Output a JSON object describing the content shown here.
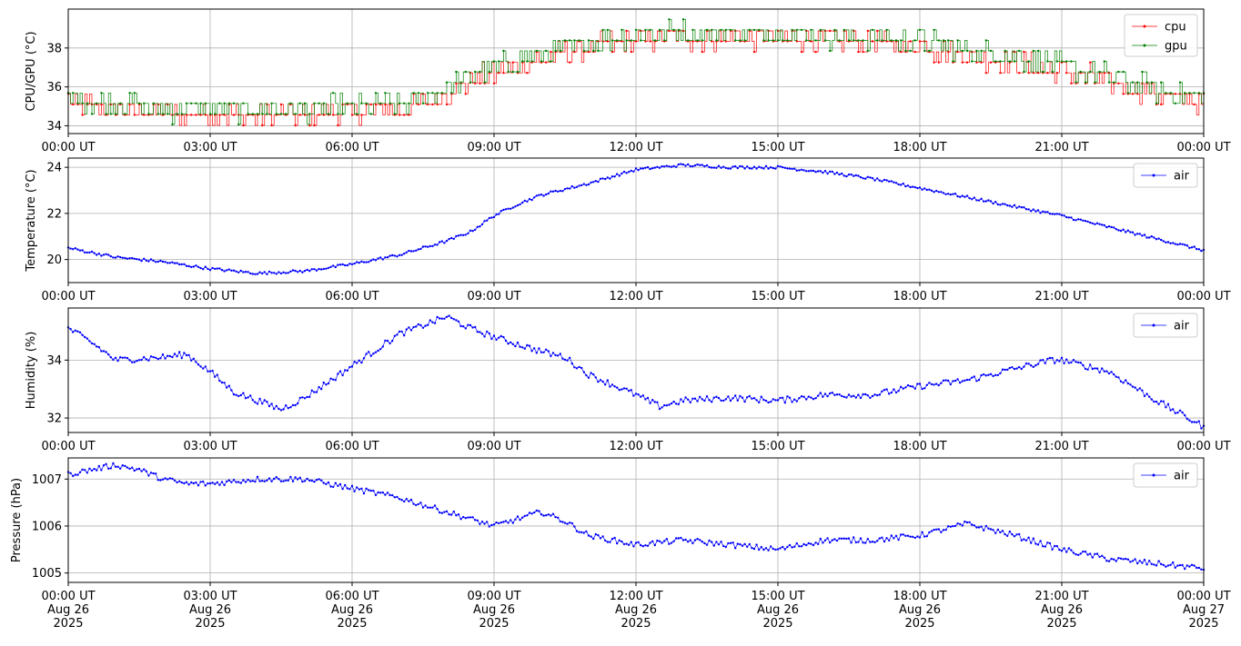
{
  "chart_data": [
    {
      "type": "line",
      "ylabel": "CPU/GPU (°C)",
      "xlim": [
        "2025-08-26T00:00Z",
        "2025-08-27T00:00Z"
      ],
      "ylim": [
        33.6,
        40.0
      ],
      "yticks": [
        34,
        36,
        38
      ],
      "grid": true,
      "legend_position": "top-right",
      "x_tick_labels": [
        "00:00 UT",
        "03:00 UT",
        "06:00 UT",
        "09:00 UT",
        "12:00 UT",
        "15:00 UT",
        "18:00 UT",
        "21:00 UT",
        "00:00 UT"
      ],
      "series": [
        {
          "name": "cpu",
          "color": "#ff0000",
          "time_hours": [
            0,
            1,
            2,
            3,
            4,
            5,
            6,
            7,
            7.5,
            8,
            8.5,
            9,
            9.5,
            10,
            11,
            12,
            13,
            14,
            15,
            16,
            17,
            18,
            19,
            20,
            21,
            22,
            23,
            24
          ],
          "values": [
            35.2,
            34.9,
            34.6,
            34.6,
            34.5,
            34.6,
            34.7,
            34.8,
            35.2,
            35.7,
            36.3,
            36.7,
            37.0,
            37.4,
            38.0,
            38.4,
            38.5,
            38.5,
            38.5,
            38.4,
            38.3,
            38.1,
            37.6,
            37.3,
            36.8,
            36.3,
            35.6,
            35.2
          ]
        },
        {
          "name": "gpu",
          "color": "#008000",
          "time_hours": [
            0,
            1,
            2,
            3,
            4,
            5,
            6,
            7,
            7.5,
            8,
            8.5,
            9,
            9.5,
            10,
            11,
            12,
            13,
            14,
            15,
            16,
            17,
            18,
            19,
            20,
            21,
            22,
            23,
            24
          ],
          "values": [
            35.4,
            35.1,
            34.8,
            34.8,
            34.7,
            34.8,
            34.9,
            35.0,
            35.4,
            35.9,
            36.5,
            36.9,
            37.2,
            37.6,
            38.2,
            38.6,
            38.7,
            38.7,
            38.7,
            38.6,
            38.5,
            38.3,
            37.8,
            37.5,
            37.0,
            36.5,
            35.8,
            35.4
          ]
        }
      ]
    },
    {
      "type": "line",
      "ylabel": "Temperature (°C)",
      "xlim": [
        "2025-08-26T00:00Z",
        "2025-08-27T00:00Z"
      ],
      "ylim": [
        19.0,
        24.4
      ],
      "yticks": [
        20,
        22,
        24
      ],
      "grid": true,
      "legend_position": "top-right",
      "x_tick_labels": [
        "00:00 UT",
        "03:00 UT",
        "06:00 UT",
        "09:00 UT",
        "12:00 UT",
        "15:00 UT",
        "18:00 UT",
        "21:00 UT",
        "00:00 UT"
      ],
      "series": [
        {
          "name": "air",
          "color": "#0000ff",
          "time_hours": [
            0,
            1,
            2,
            3,
            4,
            5,
            6,
            7,
            8,
            8.5,
            9,
            9.5,
            10,
            11,
            12,
            13,
            14,
            15,
            16,
            17,
            18,
            19,
            20,
            21,
            22,
            23,
            24
          ],
          "values": [
            20.5,
            20.1,
            19.9,
            19.6,
            19.4,
            19.5,
            19.8,
            20.2,
            20.8,
            21.2,
            21.9,
            22.4,
            22.8,
            23.3,
            23.9,
            24.1,
            24.0,
            24.0,
            23.8,
            23.5,
            23.1,
            22.7,
            22.3,
            21.9,
            21.4,
            20.9,
            20.4
          ]
        }
      ]
    },
    {
      "type": "line",
      "ylabel": "Humidity (%)",
      "xlim": [
        "2025-08-26T00:00Z",
        "2025-08-27T00:00Z"
      ],
      "ylim": [
        31.5,
        35.8
      ],
      "yticks": [
        32,
        34
      ],
      "grid": true,
      "legend_position": "top-right",
      "x_tick_labels": [
        "00:00 UT",
        "03:00 UT",
        "06:00 UT",
        "09:00 UT",
        "12:00 UT",
        "15:00 UT",
        "18:00 UT",
        "21:00 UT",
        "00:00 UT"
      ],
      "series": [
        {
          "name": "air",
          "color": "#0000ff",
          "time_hours": [
            0,
            0.5,
            1,
            2,
            2.5,
            3,
            3.5,
            4.5,
            5,
            6,
            7,
            8,
            8.5,
            9,
            10,
            10.5,
            11,
            12,
            12.5,
            13,
            14,
            15,
            16,
            17,
            18,
            19,
            20,
            20.8,
            21,
            22,
            23,
            24
          ],
          "values": [
            35.1,
            34.6,
            34.0,
            34.1,
            34.2,
            33.6,
            32.9,
            32.3,
            32.7,
            33.8,
            34.9,
            35.5,
            35.1,
            34.8,
            34.3,
            34.1,
            33.5,
            32.8,
            32.4,
            32.6,
            32.7,
            32.6,
            32.8,
            32.8,
            33.1,
            33.3,
            33.7,
            34.0,
            34.0,
            33.6,
            32.6,
            31.7
          ]
        }
      ]
    },
    {
      "type": "line",
      "ylabel": "Pressure (hPa)",
      "xlim": [
        "2025-08-26T00:00Z",
        "2025-08-27T00:00Z"
      ],
      "ylim": [
        1004.8,
        1007.45
      ],
      "yticks": [
        1005,
        1006,
        1007
      ],
      "grid": true,
      "legend_position": "top-right",
      "x_tick_labels": [
        "00:00 UT\nAug 26\n2025",
        "03:00 UT\nAug 26\n2025",
        "06:00 UT\nAug 26\n2025",
        "09:00 UT\nAug 26\n2025",
        "12:00 UT\nAug 26\n2025",
        "15:00 UT\nAug 26\n2025",
        "18:00 UT\nAug 26\n2025",
        "21:00 UT\nAug 26\n2025",
        "00:00 UT\nAug 27\n2025"
      ],
      "series": [
        {
          "name": "air",
          "color": "#0000ff",
          "time_hours": [
            0,
            0.5,
            1,
            1.5,
            2,
            2.5,
            3,
            4,
            5,
            6,
            7,
            8,
            9,
            10,
            10.5,
            11,
            12,
            13,
            14,
            15,
            16,
            17,
            18,
            19,
            20,
            21,
            22,
            23,
            24
          ],
          "values": [
            1007.1,
            1007.2,
            1007.3,
            1007.2,
            1007.0,
            1006.9,
            1006.9,
            1007.0,
            1007.0,
            1006.8,
            1006.6,
            1006.3,
            1006.0,
            1006.3,
            1006.1,
            1005.8,
            1005.6,
            1005.7,
            1005.6,
            1005.5,
            1005.7,
            1005.7,
            1005.8,
            1006.05,
            1005.8,
            1005.5,
            1005.3,
            1005.2,
            1005.1
          ]
        }
      ]
    }
  ]
}
